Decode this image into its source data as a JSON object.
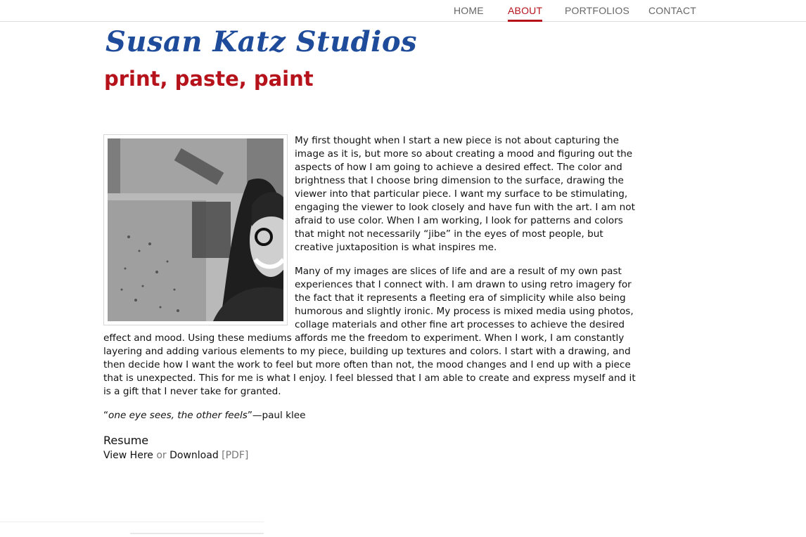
{
  "nav": {
    "items": [
      {
        "label": "HOME",
        "active": false
      },
      {
        "label": "ABOUT",
        "active": true
      },
      {
        "label": "PORTFOLIOS",
        "active": false
      },
      {
        "label": "CONTACT",
        "active": false
      }
    ]
  },
  "header": {
    "title": "Susan Katz Studios",
    "tagline": "print, paste, paint"
  },
  "about": {
    "paragraph1": "My first thought when I start a new piece is not about capturing the image as it is, but more so about creating a mood and figuring out the aspects of how I am going to achieve a desired effect. The color and brightness that I choose bring dimension to the surface, drawing the viewer into that particular piece. I want my surface to be stimulating, engaging the viewer to look closely and have fun with the art. I am not afraid to use color. When I am working, I look for patterns and colors that might not necessarily “jibe” in the eyes of most people, but creative juxtaposition is what inspires me.",
    "paragraph2": "Many of my images are slices of life and are a result of my own past experiences that I connect with. I am drawn to using retro imagery for the fact that it represents a fleeting era of simplicity while also being humorous and slightly ironic. My process is mixed media using photos, collage materials and other fine art processes to achieve the desired effect and mood. Using these mediums affords me the freedom to experiment. When I work, I am constantly layering and adding various elements to my piece, building up textures and colors. I start with a drawing, and then decide how I want the work to feel but more often than not, the mood changes and I end up with a piece that is unexpected. This for me is what I enjoy. I feel blessed that I am able to create and express myself and it is a gift that I never take for granted.",
    "quote_open": "“",
    "quote_text": "one eye sees, the other feels",
    "quote_close": "”—paul klee"
  },
  "resume": {
    "heading": "Resume",
    "view_label": "View Here",
    "or_label": "or",
    "download_label": "Download",
    "pdf_label": "[PDF]"
  },
  "colors": {
    "title": "#1f4c9a",
    "accent": "#b5121b",
    "nav_text": "#666666"
  }
}
